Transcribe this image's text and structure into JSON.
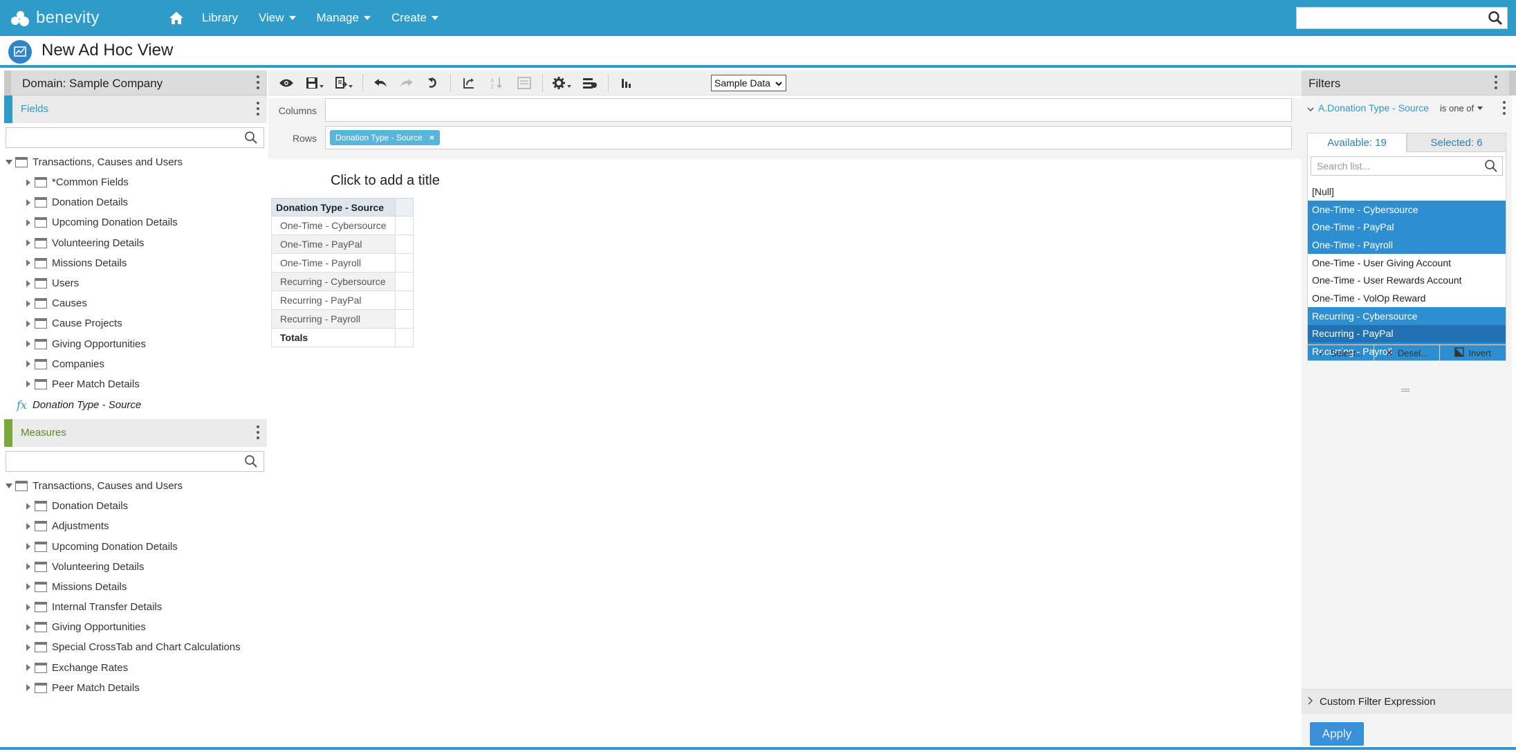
{
  "brand": {
    "name": "benevity"
  },
  "nav": {
    "home_icon": "home-icon",
    "items": [
      {
        "label": "Library",
        "has_menu": false
      },
      {
        "label": "View",
        "has_menu": true
      },
      {
        "label": "Manage",
        "has_menu": true
      },
      {
        "label": "Create",
        "has_menu": true
      }
    ],
    "search": {
      "value": "",
      "icon": "search-icon"
    }
  },
  "page": {
    "title": "New Ad Hoc View",
    "icon": "chart-line-icon"
  },
  "left_panel": {
    "domain_label": "Domain: Sample Company",
    "fields": {
      "label": "Fields",
      "accent": "#2e9bc9",
      "search_value": "",
      "root": "Transactions, Causes and Users",
      "items": [
        "*Common Fields",
        "Donation Details",
        "Upcoming Donation Details",
        "Volunteering Details",
        "Missions Details",
        "Users",
        "Causes",
        "Cause Projects",
        "Giving Opportunities",
        "Companies",
        "Peer Match Details"
      ],
      "calculated": {
        "symbol": "fx",
        "label": "Donation Type - Source"
      }
    },
    "measures": {
      "label": "Measures",
      "accent": "#7aa83d",
      "search_value": "",
      "root": "Transactions, Causes and Users",
      "items": [
        "Donation Details",
        "Adjustments",
        "Upcoming Donation Details",
        "Volunteering Details",
        "Missions Details",
        "Internal Transfer Details",
        "Giving Opportunities",
        "Special CrossTab and Chart Calculations",
        "Exchange Rates",
        "Peer Match Details"
      ]
    }
  },
  "toolbar": {
    "icons": [
      "eye-icon",
      "save-icon",
      "export-icon",
      "undo-icon",
      "redo-icon",
      "undo-all-icon",
      "pivot-icon",
      "sort-icon",
      "page-icon",
      "settings-icon",
      "options-icon",
      "chart-icon"
    ],
    "data_mode": "Sample Data"
  },
  "canvas": {
    "columns_label": "Columns",
    "rows_label": "Rows",
    "row_chip": "Donation Type - Source",
    "chip_remove": "×",
    "title_placeholder": "Click to add a title",
    "table": {
      "header": "Donation Type - Source",
      "rows": [
        "One-Time - Cybersource",
        "One-Time - PayPal",
        "One-Time - Payroll",
        "Recurring - Cybersource",
        "Recurring - PayPal",
        "Recurring - Payroll"
      ],
      "totals_label": "Totals"
    }
  },
  "filters": {
    "title": "Filters",
    "filter_name": "A.Donation Type - Source",
    "operator": "is one of",
    "tab_available": "Available: 19",
    "tab_selected": "Selected: 6",
    "search_placeholder": "Search list...",
    "options": [
      {
        "label": "[Null]",
        "state": "none"
      },
      {
        "label": "One-Time - Cybersource",
        "state": "selected"
      },
      {
        "label": "One-Time - PayPal",
        "state": "selected"
      },
      {
        "label": "One-Time - Payroll",
        "state": "selected"
      },
      {
        "label": "One-Time - User Giving Account",
        "state": "none"
      },
      {
        "label": "One-Time - User Rewards Account",
        "state": "none"
      },
      {
        "label": "One-Time - VolOp Reward",
        "state": "none"
      },
      {
        "label": "Recurring - Cybersource",
        "state": "selected"
      },
      {
        "label": "Recurring - PayPal",
        "state": "focused"
      },
      {
        "label": "Recurring - Payroll",
        "state": "selected"
      }
    ],
    "actions": {
      "select": "Select...",
      "deselect": "Desel...",
      "invert": "Invert"
    },
    "custom_expression": "Custom Filter Expression",
    "apply": "Apply"
  },
  "colors": {
    "brand": "#2e9bc9",
    "selection": "#2e8fd0",
    "apply": "#3b8fd6"
  }
}
